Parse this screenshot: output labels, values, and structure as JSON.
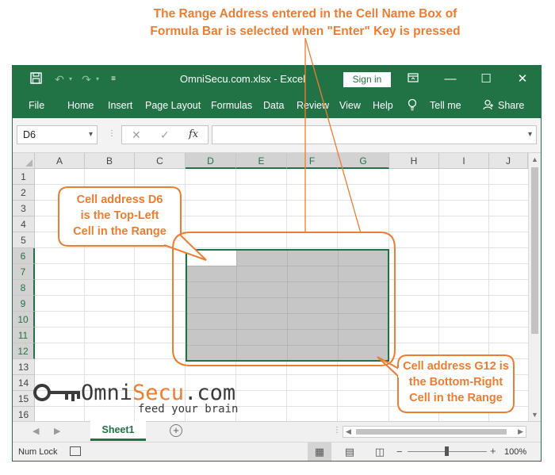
{
  "annotations": {
    "top_line1": "The Range Address entered in the Cell Name Box of",
    "top_line2": "Formula Bar is selected when \"Enter\" Key is pressed",
    "left_line1": "Cell address D6",
    "left_line2": "is the Top-Left",
    "left_line3": "Cell in the Range",
    "right_line1": "Cell address G12 is",
    "right_line2": "the Bottom-Right",
    "right_line3": "Cell in the Range",
    "color": "#ed7d31"
  },
  "titlebar": {
    "title": "OmniSecu.com.xlsx  -  Excel",
    "sign_in": "Sign in",
    "qat_icons": [
      "save-icon",
      "undo-icon",
      "redo-icon",
      "customize-icon"
    ],
    "window_controls": [
      "ribbon-display-icon",
      "minimize-icon",
      "maximize-icon",
      "close-icon"
    ],
    "color": "#217346"
  },
  "menu": {
    "items": [
      "File",
      "Home",
      "Insert",
      "Page Layout",
      "Formulas",
      "Data",
      "Review",
      "View",
      "Help"
    ],
    "tell_me": "Tell me",
    "share": "Share"
  },
  "formula_bar": {
    "name_box_value": "D6",
    "fx_label": "fx",
    "formula_value": ""
  },
  "grid": {
    "columns": [
      "A",
      "B",
      "C",
      "D",
      "E",
      "F",
      "G",
      "H",
      "I",
      "J"
    ],
    "rows": [
      "1",
      "2",
      "3",
      "4",
      "5",
      "6",
      "7",
      "8",
      "9",
      "10",
      "11",
      "12",
      "13",
      "14",
      "15",
      "16"
    ],
    "selected_range": "D6:G12",
    "active_cell": "D6"
  },
  "sheets": {
    "tabs": [
      "Sheet1"
    ],
    "active": "Sheet1"
  },
  "status": {
    "mode": "Num Lock",
    "zoom": "100%"
  },
  "logo": {
    "omni": "Omni",
    "secu": "Secu",
    "dotcom": ".com",
    "tagline": "feed your brain"
  }
}
